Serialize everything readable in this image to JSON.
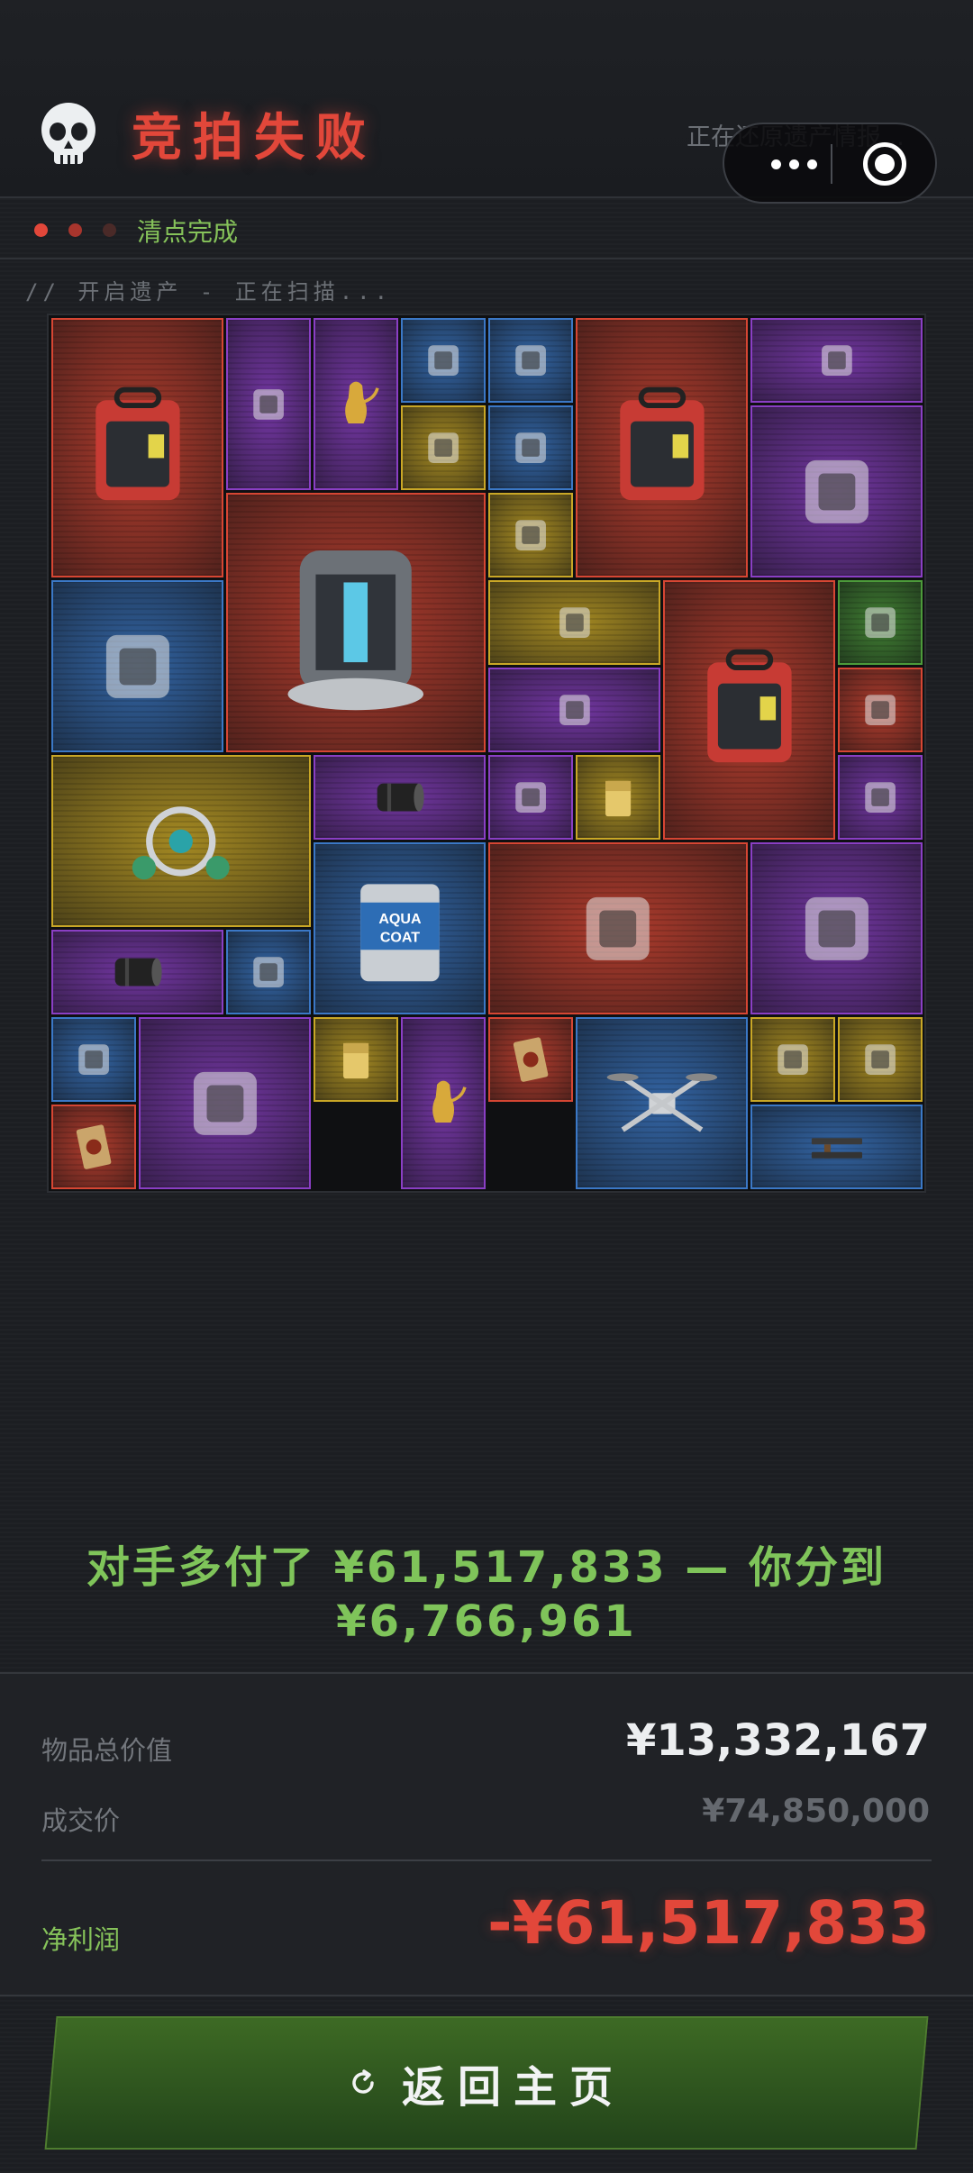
{
  "header": {
    "title": "竞拍失败",
    "loading_hint": "正在还原遗产情报...",
    "skull_icon": "skull-icon"
  },
  "status": {
    "label": "清点完成",
    "dot_colors": [
      "#e2473a",
      "#a8352d",
      "#4a2a28"
    ]
  },
  "scan_line": "// 开启遗产 - 正在扫描...",
  "rarity_colors": {
    "red": "#d64633",
    "purple": "#8a3fc4",
    "blue": "#3b78c6",
    "gold": "#c9a726",
    "green": "#4c9a3a"
  },
  "items": [
    {
      "name": "aed-defibrillator",
      "rarity": "red"
    },
    {
      "name": "black-tide-book",
      "rarity": "purple"
    },
    {
      "name": "golden-teapot",
      "rarity": "purple"
    },
    {
      "name": "power-supply-knob",
      "rarity": "blue"
    },
    {
      "name": "wooden-bird-figurine",
      "rarity": "blue"
    },
    {
      "name": "aed-defibrillator",
      "rarity": "red"
    },
    {
      "name": "packaged-device",
      "rarity": "purple"
    },
    {
      "name": "pill-box",
      "rarity": "gold"
    },
    {
      "name": "ancient-coin",
      "rarity": "blue"
    },
    {
      "name": "telescope-device",
      "rarity": "purple"
    },
    {
      "name": "reactor-core",
      "rarity": "red"
    },
    {
      "name": "emblem-medal",
      "rarity": "gold"
    },
    {
      "name": "rotary-hammer-drill",
      "rarity": "blue"
    },
    {
      "name": "handheld-terminal",
      "rarity": "gold"
    },
    {
      "name": "aed-defibrillator",
      "rarity": "red"
    },
    {
      "name": "pen-tester",
      "rarity": "green"
    },
    {
      "name": "boombox-speaker",
      "rarity": "purple"
    },
    {
      "name": "usb-stick",
      "rarity": "red"
    },
    {
      "name": "jewel-amulet",
      "rarity": "gold"
    },
    {
      "name": "camera-lens",
      "rarity": "purple"
    },
    {
      "name": "cloth-vest",
      "rarity": "purple"
    },
    {
      "name": "zippo-lighter",
      "rarity": "gold"
    },
    {
      "name": "drink-can",
      "rarity": "purple"
    },
    {
      "name": "aqua-coat-paint-bucket",
      "rarity": "blue",
      "label": "AQUA COAT"
    },
    {
      "name": "rugged-field-laptop",
      "rarity": "red"
    },
    {
      "name": "lab-incubator",
      "rarity": "purple"
    },
    {
      "name": "camera-lens",
      "rarity": "purple"
    },
    {
      "name": "optical-disc",
      "rarity": "blue"
    },
    {
      "name": "medicine-bottle",
      "rarity": "blue"
    },
    {
      "name": "coffee-machine",
      "rarity": "purple"
    },
    {
      "name": "zippo-lighter",
      "rarity": "gold"
    },
    {
      "name": "golden-teapot",
      "rarity": "purple"
    },
    {
      "name": "ornate-card",
      "rarity": "red"
    },
    {
      "name": "camera-drone",
      "rarity": "blue"
    },
    {
      "name": "gold-circuit-board",
      "rarity": "gold"
    },
    {
      "name": "ssd-stick",
      "rarity": "gold"
    },
    {
      "name": "ornate-card",
      "rarity": "red"
    },
    {
      "name": "assault-rifles",
      "rarity": "blue"
    }
  ],
  "summary": {
    "line1": "对手多付了 ¥61,517,833 — 你分到",
    "line2": "¥6,766,961"
  },
  "stats": {
    "total_value_label": "物品总价值",
    "total_value": "¥13,332,167",
    "deal_price_label": "成交价",
    "deal_price": "¥74,850,000",
    "net_profit_label": "净利润",
    "net_profit": "-¥61,517,833",
    "net_profit_color": "#e2473a"
  },
  "home_button": {
    "label": "返回主页",
    "icon": "refresh-icon"
  }
}
